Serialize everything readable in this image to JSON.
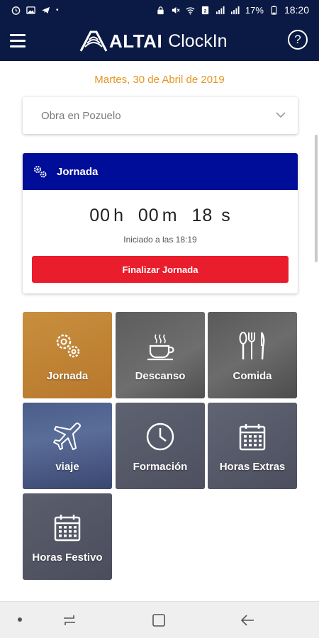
{
  "status_bar": {
    "time": "18:20",
    "battery": "17%"
  },
  "app_bar": {
    "brand": "ALTAI",
    "app_name": "ClockIn",
    "help_label": "?"
  },
  "date": "Martes, 30 de Abril de 2019",
  "site_select": {
    "value": "Obra en Pozuelo"
  },
  "jornada_card": {
    "title": "Jornada",
    "timer": {
      "hours": "00",
      "hours_unit": "h",
      "minutes": "00",
      "minutes_unit": "m",
      "seconds": "18",
      "seconds_unit": "s"
    },
    "started_text": "Iniciado a las 18:19",
    "finish_button": "Finalizar Jornada"
  },
  "tiles": [
    {
      "label": "Jornada",
      "icon": "gears-icon"
    },
    {
      "label": "Descanso",
      "icon": "coffee-cup-icon"
    },
    {
      "label": "Comida",
      "icon": "cutlery-icon"
    },
    {
      "label": "viaje",
      "icon": "airplane-icon"
    },
    {
      "label": "Formación",
      "icon": "clock-icon"
    },
    {
      "label": "Horas Extras",
      "icon": "calendar-icon"
    },
    {
      "label": "Horas Festivo",
      "icon": "calendar-icon"
    }
  ],
  "colors": {
    "app_bar": "#0b1a44",
    "date_text": "#e39520",
    "card_header": "#000d99",
    "finish_button": "#ea1d2c",
    "jornada_tile": "#c58a3a"
  }
}
